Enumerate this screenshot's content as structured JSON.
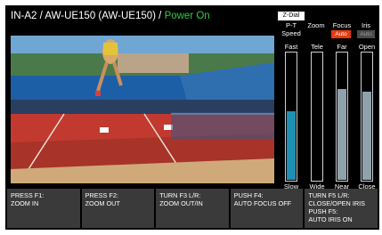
{
  "header": {
    "camera": "IN-A2 / AW-UE150 (AW-UE150) / ",
    "status": "Power On",
    "status_color": "#2ecc40"
  },
  "controls": {
    "zdial": "Z-Dial",
    "pt_speed": {
      "head1": "P-T",
      "head2": "Speed",
      "top": "Fast",
      "bottom": "Slow",
      "level": 0.55
    },
    "zoom": {
      "head": "Zoom",
      "top": "Tele",
      "bottom": "Wide",
      "level": 0.0
    },
    "focus": {
      "head": "Focus",
      "badge": "Auto",
      "top": "Far",
      "bottom": "Near",
      "level": 0.72
    },
    "iris": {
      "head": "Iris",
      "badge": "Auto",
      "top": "Open",
      "bottom": "Close",
      "level": 0.7
    }
  },
  "functions": [
    {
      "line1": "PRESS F1:",
      "line2": "ZOOM IN"
    },
    {
      "line1": "PRESS F2:",
      "line2": "ZOOM OUT"
    },
    {
      "line1": "TURN F3 L/R:",
      "line2": "ZOOM OUT/IN"
    },
    {
      "line1": "PUSH F4:",
      "line2": "AUTO FOCUS OFF"
    },
    {
      "line1": "TURN F5 L/R:",
      "line2": "CLOSE/OPEN IRIS",
      "line3": "PUSH F5:",
      "line4": "AUTO IRIS ON"
    }
  ]
}
